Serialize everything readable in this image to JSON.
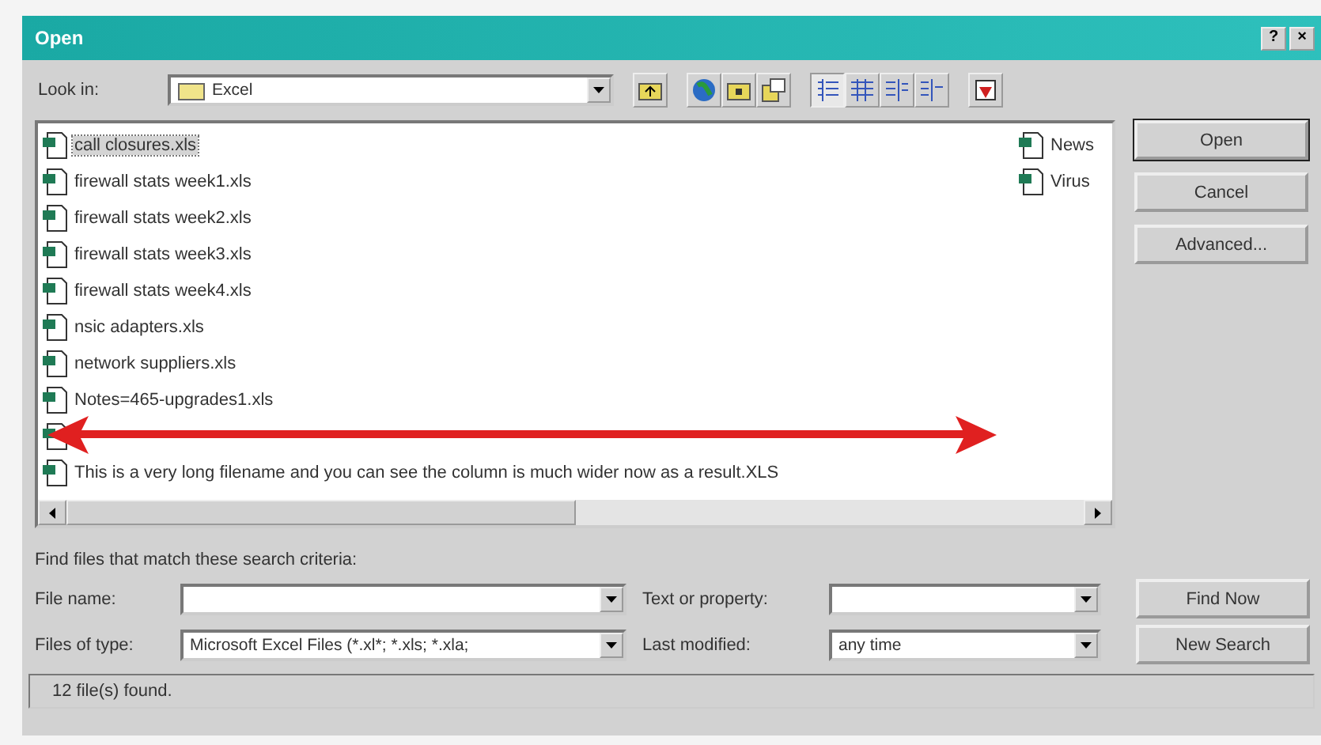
{
  "window": {
    "title": "Open",
    "help_button": "?",
    "close_button": "×"
  },
  "look_in": {
    "label": "Look in:",
    "value": "Excel"
  },
  "toolbar": [
    {
      "kind": "up"
    },
    {
      "kind": "web"
    },
    {
      "kind": "newfolder"
    },
    {
      "kind": "tools"
    },
    {
      "kind": "list",
      "selected": true
    },
    {
      "kind": "details",
      "selected": false
    },
    {
      "kind": "properties",
      "selected": false
    },
    {
      "kind": "preview",
      "selected": false
    },
    {
      "kind": "commands"
    }
  ],
  "files": [
    {
      "name": "call closures.xls",
      "selected": true
    },
    {
      "name": "firewall stats week1.xls",
      "selected": false
    },
    {
      "name": "firewall stats week2.xls",
      "selected": false
    },
    {
      "name": "firewall stats week3.xls",
      "selected": false
    },
    {
      "name": "firewall stats week4.xls",
      "selected": false
    },
    {
      "name": "nsic adapters.xls",
      "selected": false
    },
    {
      "name": "network suppliers.xls",
      "selected": false
    },
    {
      "name": "Notes=465-upgrades1.xls",
      "selected": false
    },
    {
      "covered_row_before": true,
      "name": "This is a very long filename and you can see the column is much wider now as a result.XLS",
      "selected": false
    }
  ],
  "files_column_2": [
    {
      "name": "News"
    },
    {
      "name": "Virus"
    }
  ],
  "buttons": [
    "Open",
    "Cancel",
    "Advanced..."
  ],
  "search": {
    "heading": "Find files that match these search criteria:",
    "file_name": {
      "label": "File name:"
    },
    "files_of_type": {
      "label": "Files of type:",
      "value": "Microsoft Excel Files (*.xl*; *.xls; *.xla;"
    },
    "text_or_property": {
      "label": "Text or property:"
    },
    "last_modified": {
      "label": "Last modified:",
      "value": "any time"
    },
    "buttons": [
      "Find Now",
      "New Search"
    ]
  },
  "status_bar": "12 file(s) found."
}
